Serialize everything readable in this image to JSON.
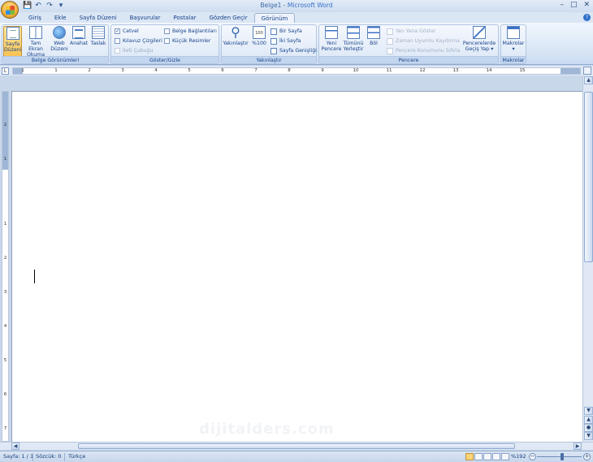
{
  "window": {
    "doc_name": "Belge1",
    "separator": " - ",
    "app_name": "Microsoft Word",
    "min": "–",
    "max": "□",
    "close": "✕"
  },
  "qat": {
    "save": "💾",
    "undo": "↶",
    "redo": "↷",
    "more": "▾"
  },
  "tabs": [
    "Giriş",
    "Ekle",
    "Sayfa Düzeni",
    "Başvurular",
    "Postalar",
    "Gözden Geçir",
    "Görünüm"
  ],
  "help": "?",
  "ribbon": {
    "views": {
      "label": "Belge Görünümleri",
      "buttons": [
        {
          "line1": "Sayfa",
          "line2": "Düzeni"
        },
        {
          "line1": "Tam Ekran",
          "line2": "Okuma"
        },
        {
          "line1": "Web",
          "line2": "Düzeni"
        },
        {
          "line1": "Anahat",
          "line2": ""
        },
        {
          "line1": "Taslak",
          "line2": ""
        }
      ]
    },
    "showhide": {
      "label": "Göster/Gizle",
      "items": [
        {
          "text": "Cetvel",
          "checked": "✓"
        },
        {
          "text": "Kılavuz Çizgileri",
          "checked": ""
        },
        {
          "text": "İleti Çubuğu",
          "checked": ""
        },
        {
          "text": "Belge Bağlantıları",
          "checked": ""
        },
        {
          "text": "Küçük Resimler",
          "checked": ""
        }
      ]
    },
    "zoom": {
      "label": "Yakınlaştır",
      "zoom_btn": "Yakınlaştır",
      "pct_btn": "%100",
      "pct_icon": "100",
      "one_page": "Bir Sayfa",
      "two_pages": "İki Sayfa",
      "page_width": "Sayfa Genişliği"
    },
    "window": {
      "label": "Pencere",
      "new": {
        "line1": "Yeni",
        "line2": "Pencere"
      },
      "arrange": {
        "line1": "Tümünü",
        "line2": "Yerleştir"
      },
      "split": {
        "line1": "Böl",
        "line2": ""
      },
      "side_by_side": "Yan Yana Göster",
      "sync_scroll": "Zaman Uyumlu Kaydırma",
      "reset_pos": "Pencere Konumunu Sıfırla",
      "switch": {
        "line1": "Pencerelerde",
        "line2": "Geçiş Yap ▾"
      }
    },
    "macros": {
      "label": "Makrolar",
      "btn": {
        "line1": "Makrolar",
        "line2": "▾"
      }
    }
  },
  "ruler": {
    "corner": "L",
    "h_numbers": [
      "1",
      "1",
      "2",
      "3",
      "4",
      "5",
      "6",
      "7",
      "8",
      "9",
      "10",
      "11",
      "12",
      "13",
      "14",
      "15"
    ],
    "v_numbers": [
      "2",
      "1",
      "1",
      "2",
      "3",
      "4",
      "5",
      "6",
      "7",
      "8"
    ]
  },
  "scroll": {
    "up": "▲",
    "down": "▼",
    "left": "◀",
    "right": "▶",
    "prev": "▲",
    "browse": "●",
    "next": "▼"
  },
  "watermark": "dijitalders.com",
  "status": {
    "page": "Sayfa: 1 / 1",
    "words": "Sözcük: 0",
    "lang": "Türkçe",
    "zoom": "%192",
    "minus": "−",
    "plus": "+"
  }
}
